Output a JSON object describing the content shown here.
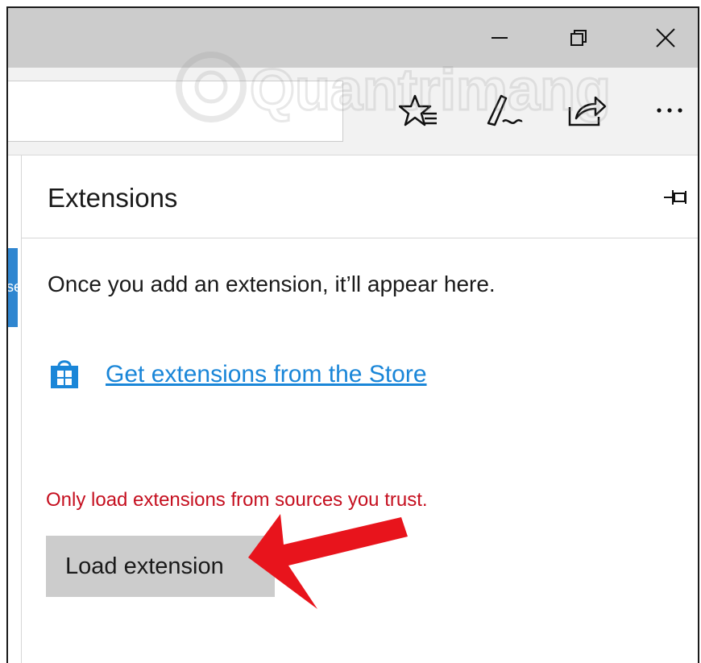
{
  "window": {
    "minimize_icon": "minimize-icon",
    "restore_icon": "restore-icon",
    "close_icon": "close-icon"
  },
  "toolbar": {
    "icons": [
      "favorites-list-icon",
      "web-note-pen-icon",
      "share-icon",
      "more-icon"
    ]
  },
  "side_tab": {
    "text": "se"
  },
  "panel": {
    "title": "Extensions",
    "pin_icon": "pin-icon",
    "empty_message": "Once you add an extension, it’ll appear here.",
    "store_icon": "store-bag-icon",
    "store_link": "Get extensions from the Store",
    "warning": "Only load extensions from sources you trust.",
    "load_button": "Load extension"
  },
  "overlay": {
    "watermark": "Quantrimang",
    "arrow_color": "#e8141c"
  },
  "colors": {
    "link": "#1a86d8",
    "warning": "#c50f1f",
    "title_bar": "#cccccc",
    "button_bg": "#cccccc"
  }
}
